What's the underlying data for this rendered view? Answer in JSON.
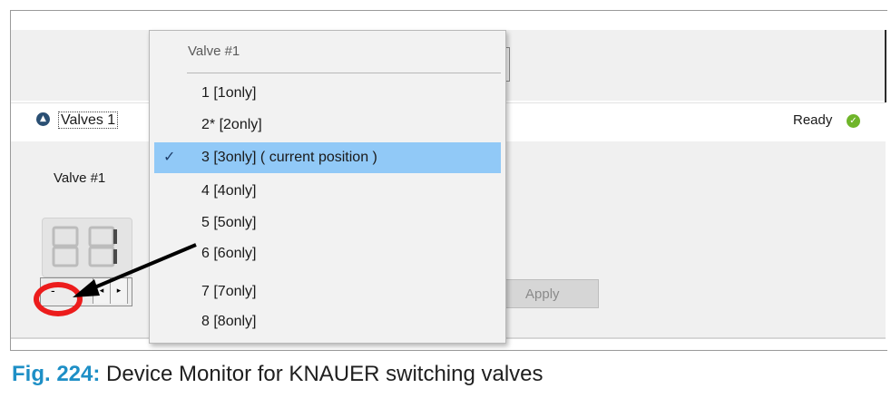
{
  "header": {
    "section_title": "Valves 1",
    "status": "Ready"
  },
  "valve": {
    "label": "Valve #1",
    "stepper": {
      "minus_label": "-",
      "prev_glyph": "◂",
      "next_glyph": "▸"
    }
  },
  "apply_label": "Apply",
  "dropdown": {
    "header": "Valve #1",
    "items": [
      {
        "label": "1 [1only]",
        "checked": false
      },
      {
        "label": "2* [2only]",
        "checked": false
      },
      {
        "label": "3 [3only]  ( current position )",
        "checked": true
      },
      {
        "label": "4 [4only]",
        "checked": false
      },
      {
        "label": "5 [5only]",
        "checked": false
      },
      {
        "label": "6 [6only]",
        "checked": false
      },
      {
        "label": "7 [7only]",
        "checked": false
      },
      {
        "label": "8 [8only]",
        "checked": false
      }
    ],
    "check_glyph": "✓"
  },
  "caption": {
    "fig_label": "Fig. 224:",
    "text": "Device Monitor for KNAUER switching valves"
  },
  "colors": {
    "accent": "#1e8fc6",
    "selection": "#91c9f7",
    "annotation_red": "#ec1c1c",
    "status_green": "#6fb52a"
  },
  "icons": [
    "chevron-up-icon",
    "check-circle-icon",
    "checkmark-icon",
    "arrow-annotation"
  ]
}
